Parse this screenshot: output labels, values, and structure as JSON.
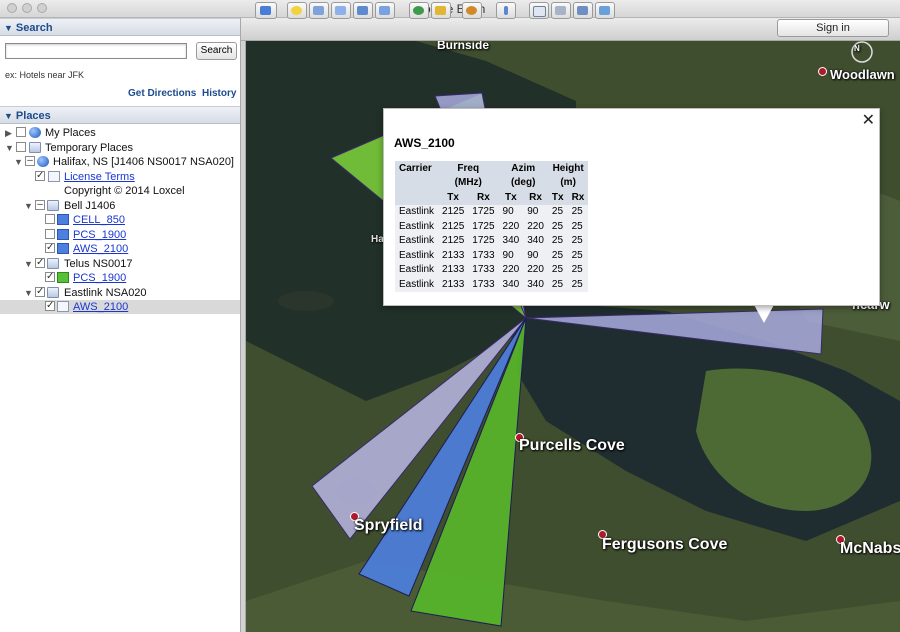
{
  "window": {
    "title": "Google Earth"
  },
  "search": {
    "header": "Search",
    "placeholder": "",
    "button": "Search",
    "hint": "ex: Hotels near JFK",
    "get_directions": "Get Directions",
    "history": "History"
  },
  "places": {
    "header": "Places",
    "items": [
      {
        "label": "My Places",
        "icon": "globe-icon"
      },
      {
        "label": "Temporary Places",
        "icon": "folder-icon"
      },
      {
        "label": "Halifax, NS [J1406 NS0017 NSA020]",
        "icon": "globe-icon"
      },
      {
        "label": "License Terms",
        "icon": "document-icon"
      },
      {
        "label": "Copyright © 2014 Loxcel"
      },
      {
        "label": "Bell J1406",
        "icon": "folder-icon"
      },
      {
        "label": "CELL_850",
        "icon": "polygon-icon"
      },
      {
        "label": "PCS_1900",
        "icon": "polygon-icon"
      },
      {
        "label": "AWS_2100",
        "icon": "polygon-icon"
      },
      {
        "label": "Telus NS0017",
        "icon": "folder-icon"
      },
      {
        "label": "PCS_1900",
        "icon": "polygon-icon"
      },
      {
        "label": "Eastlink NSA020",
        "icon": "folder-icon"
      },
      {
        "label": "AWS_2100",
        "icon": "polygon-icon"
      }
    ]
  },
  "toolbar": {
    "sign_in": "Sign in"
  },
  "map": {
    "labels": {
      "burnside": "Burnside",
      "woodlawn": "Woodlawn",
      "purcells_cove": "Purcells Cove",
      "spryfield": "Spryfield",
      "fergusons_cove": "Fergusons Cove",
      "mcnabs": "McNabs",
      "fragment_ha": "Ha",
      "fragment_ncarw": "ncarw"
    },
    "compass": "N"
  },
  "popup": {
    "title": "AWS_2100",
    "headers": [
      "Carrier",
      "Freq",
      "Azim",
      "Height"
    ],
    "units": [
      "(MHz)",
      "(deg)",
      "(m)"
    ],
    "sub": [
      "Tx",
      "Rx",
      "Tx",
      "Rx",
      "Tx",
      "Rx"
    ],
    "rows": [
      [
        "Eastlink",
        "2125",
        "1725",
        "90",
        "90",
        "25",
        "25"
      ],
      [
        "Eastlink",
        "2125",
        "1725",
        "220",
        "220",
        "25",
        "25"
      ],
      [
        "Eastlink",
        "2125",
        "1725",
        "340",
        "340",
        "25",
        "25"
      ],
      [
        "Eastlink",
        "2133",
        "1733",
        "90",
        "90",
        "25",
        "25"
      ],
      [
        "Eastlink",
        "2133",
        "1733",
        "220",
        "220",
        "25",
        "25"
      ],
      [
        "Eastlink",
        "2133",
        "1733",
        "340",
        "340",
        "25",
        "25"
      ]
    ]
  },
  "colors": {
    "sector_lavender": "#a9acdf",
    "sector_blue": "#4c7fe0",
    "sector_green": "#58b82a",
    "sector_lightgreen": "#7ed43a"
  }
}
